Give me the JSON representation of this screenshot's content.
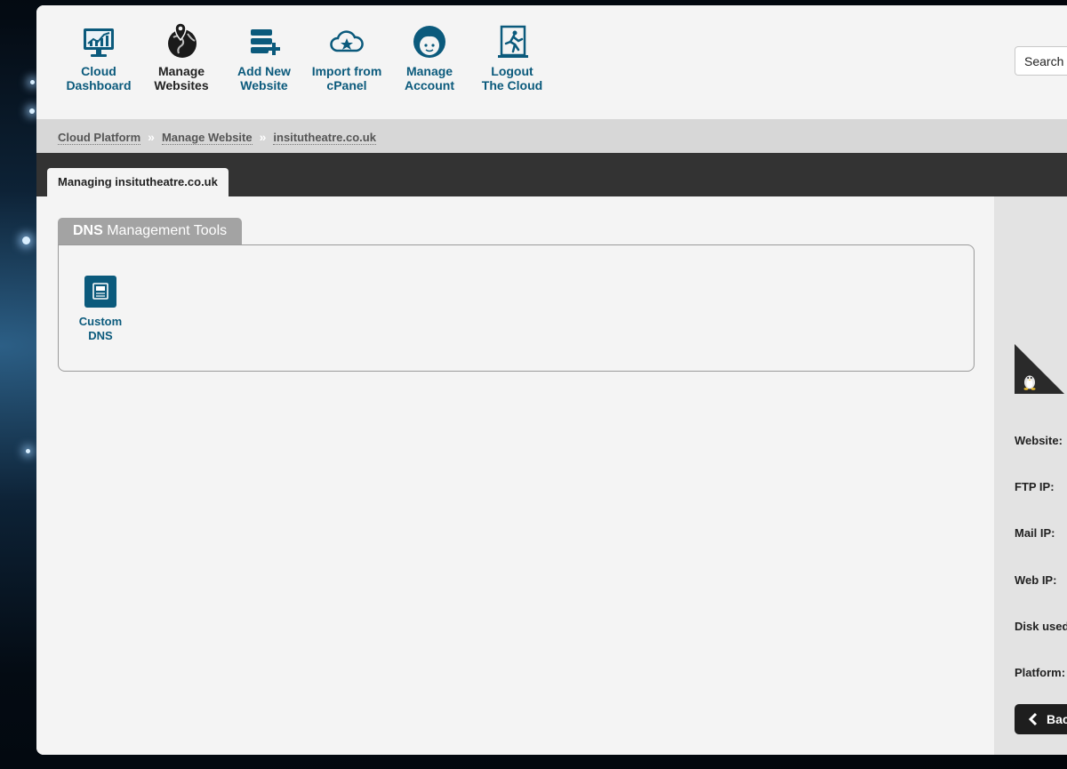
{
  "nav": {
    "items": [
      {
        "line1": "Cloud",
        "line2": "Dashboard",
        "icon": "monitor-chart-icon"
      },
      {
        "line1": "Manage",
        "line2": "Websites",
        "icon": "globe-pin-icon"
      },
      {
        "line1": "Add New",
        "line2": "Website",
        "icon": "server-add-icon"
      },
      {
        "line1": "Import from",
        "line2": "cPanel",
        "icon": "cloud-star-icon"
      },
      {
        "line1": "Manage",
        "line2": "Account",
        "icon": "user-face-icon"
      },
      {
        "line1": "Logout",
        "line2": "The Cloud",
        "icon": "exit-door-icon"
      }
    ],
    "search_placeholder": "Search",
    "accent": "#0b5a7c"
  },
  "breadcrumb": {
    "items": [
      "Cloud Platform",
      "Manage Website"
    ],
    "separator": "»",
    "current": "insitutheatre.co.uk"
  },
  "tabs": {
    "active": "Managing insitutheatre.co.uk"
  },
  "dns_section": {
    "title_bold": "DNS",
    "title_rest": " Management Tools",
    "tools": [
      {
        "line1": "Custom",
        "line2": "DNS",
        "icon": "dns-icon"
      }
    ]
  },
  "sidebar": {
    "platform_icon": "tux-linux-icon",
    "labels": [
      "Website:",
      "FTP IP:",
      "Mail IP:",
      "Web IP:",
      "Disk used",
      "Platform:"
    ],
    "back_label": "Bac"
  }
}
